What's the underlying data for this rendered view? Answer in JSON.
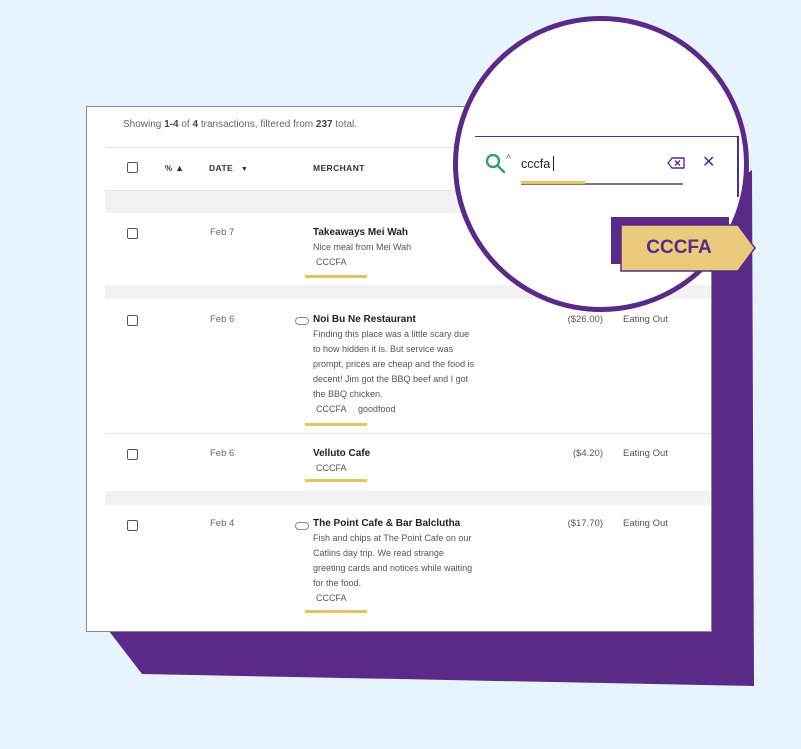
{
  "summary": {
    "prefix": "Showing",
    "range": "1-4",
    "of_text": "of",
    "count": "4",
    "mid_text": "transactions, filtered from",
    "total": "237",
    "suffix": "total."
  },
  "header": {
    "sort_icon_label": "%",
    "date_label": "DATE",
    "merchant_label": "MERCHANT"
  },
  "transactions": [
    {
      "date": "Feb 7",
      "merchant": "Takeaways Mei Wah",
      "note_lines": [
        "Nice meal from Mei Wah"
      ],
      "tags": [
        "CCCFA"
      ],
      "amount": "",
      "category": "",
      "attachment": false
    },
    {
      "date": "Feb 6",
      "merchant": "Noi Bu Ne Restaurant",
      "note_lines": [
        "Finding this place was a little scary due",
        "to how hidden it is. But service was",
        "prompt, prices are cheap and the food is",
        "decent! Jim got the BBQ beef and I got",
        "the BBQ chicken."
      ],
      "tags": [
        "CCCFA",
        "goodfood"
      ],
      "amount": "($26.00)",
      "category": "Eating Out",
      "attachment": true
    },
    {
      "date": "Feb 6",
      "merchant": "Velluto Cafe",
      "note_lines": [],
      "tags": [
        "CCCFA"
      ],
      "amount": "($4.20)",
      "category": "Eating Out",
      "attachment": false
    },
    {
      "date": "Feb 4",
      "merchant": "The Point Cafe & Bar Balclutha",
      "note_lines": [
        "Fish and chips at The Point Cafe on our",
        "Catlins day trip. We read strange",
        "greeting cards and notices while waiting",
        "for the food."
      ],
      "tags": [
        "CCCFA"
      ],
      "amount": "($17.70)",
      "category": "Eating Out",
      "attachment": true
    }
  ],
  "search": {
    "value": "cccfa"
  },
  "tag_badge": {
    "label": "CCCFA"
  },
  "colors": {
    "accent_purple": "#5a2a87",
    "highlight_yellow": "#e6c35c",
    "search_icon_green": "#3a9a7a",
    "background": "#e8f4fd"
  }
}
